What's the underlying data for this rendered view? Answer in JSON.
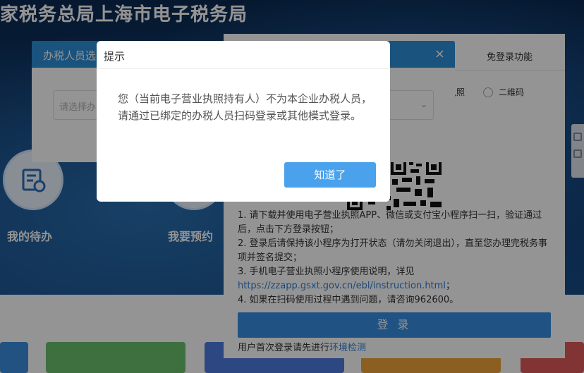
{
  "site": {
    "title": "家税务总局上海市电子税务局"
  },
  "features": [
    {
      "label": "我的待办",
      "icon": "todo-icon"
    },
    {
      "label": "我要预约",
      "icon": "appointment-icon"
    }
  ],
  "login_panel": {
    "tab_free_login": "免登录功能",
    "radio_license": "执照",
    "radio_qrcode": "二维码",
    "instructions": {
      "line1": "1. 请下载并使用电子营业执照APP、微信或支付宝小程序扫一扫，验证通过后，点击下方登录按钮；",
      "line2": "2. 登录后请保持该小程序为打开状态（请勿关闭退出），直至您办理完税务事项并签名提交；",
      "line3_prefix": "3. 手机电子营业执照小程序使用说明，详见",
      "line3_link": "https://zzapp.gsxt.gov.cn/ebl/instruction.html",
      "line3_suffix": "；",
      "line4": "4. 如果在扫码使用过程中遇到问题，请咨询962600。"
    },
    "login_button": "登 录",
    "footer_prefix": "用户首次登录请先进行",
    "footer_link": "环境检测"
  },
  "select_dialog": {
    "title": "办税人员选",
    "close_icon": "×",
    "placeholder": "请选择办",
    "chevron_icon": "⌄"
  },
  "alert": {
    "title": "提示",
    "message": "您（当前电子营业执照持有人）不为本企业办税人员，请通过已绑定的办税人员扫码登录或其他模式登录。",
    "ok_button": "知道了"
  },
  "colors": {
    "primary_blue": "#2d8fd8",
    "button_blue": "#4aa2ec",
    "link_blue": "#2d7fd4"
  }
}
